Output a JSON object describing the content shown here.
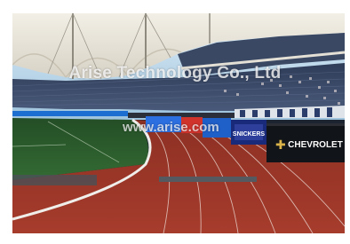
{
  "watermark": {
    "company": "Arise Technology Co., Ltd",
    "url": "www.arise.com"
  },
  "boards": {
    "sponsor_1": "CHEVROLET",
    "sponsor_2": "SNICKERS"
  },
  "colors": {
    "track": "#9a3528",
    "grass": "#2b5a2c",
    "roof": "#e8e5dc",
    "sky": "#bcd8ea",
    "seats": "#3c4a66"
  }
}
